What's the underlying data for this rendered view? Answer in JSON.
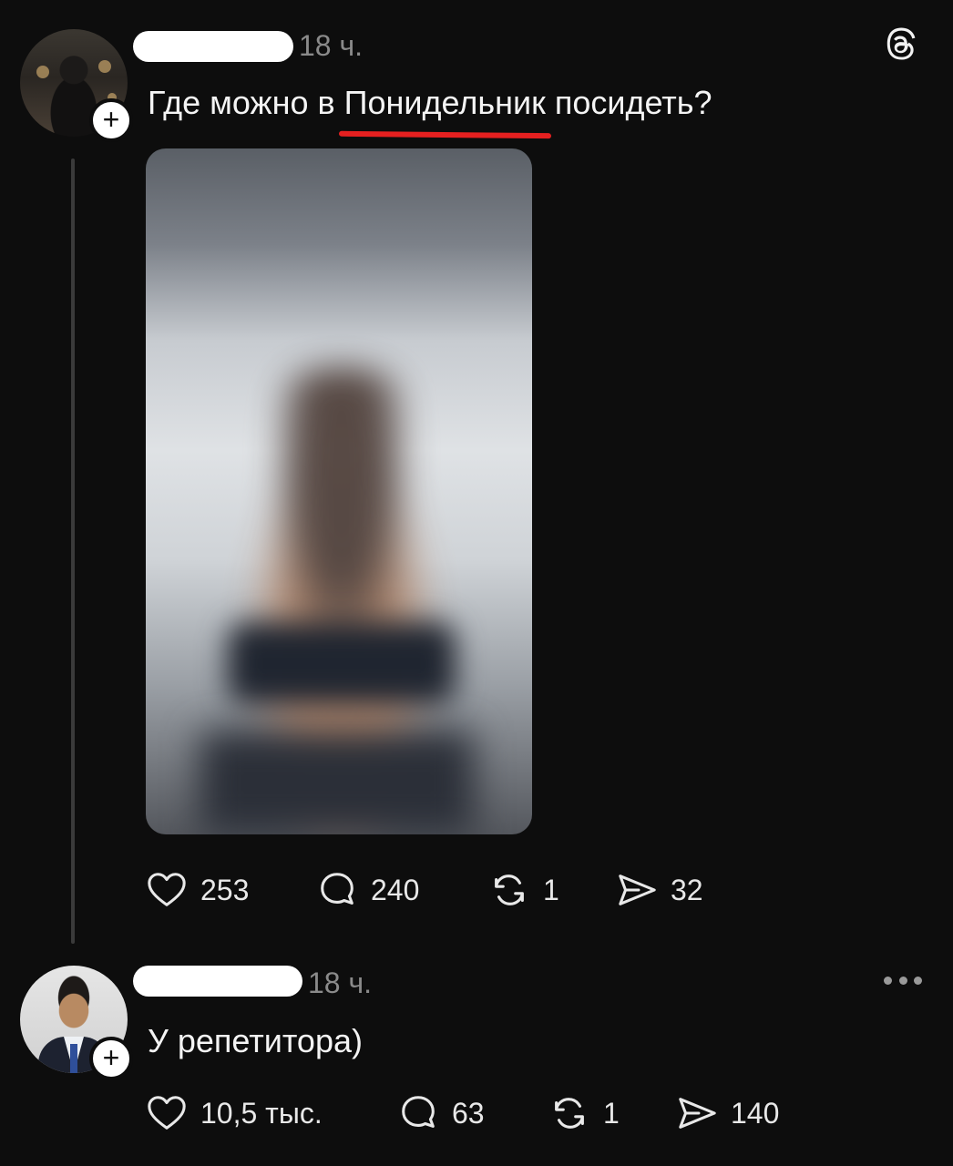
{
  "post": {
    "time": "18 ч.",
    "text_before": "Где можно в ",
    "text_highlight": "Понидельник",
    "text_after": " посидеть?",
    "media": "blurred-video-image",
    "actions": {
      "likes": "253",
      "replies": "240",
      "reposts": "1",
      "shares": "32"
    }
  },
  "reply": {
    "time": "18 ч.",
    "text": "У репетитора)",
    "actions": {
      "likes": "10,5 тыс.",
      "replies": "63",
      "reposts": "1",
      "shares": "140"
    }
  },
  "icons": {
    "follow": "+",
    "app_logo": "threads-logo-icon",
    "more": "more-dots-icon"
  },
  "colors": {
    "background": "#0d0d0d",
    "text": "#f4f4f4",
    "muted": "#8a8a8a",
    "underline": "#e52020"
  }
}
